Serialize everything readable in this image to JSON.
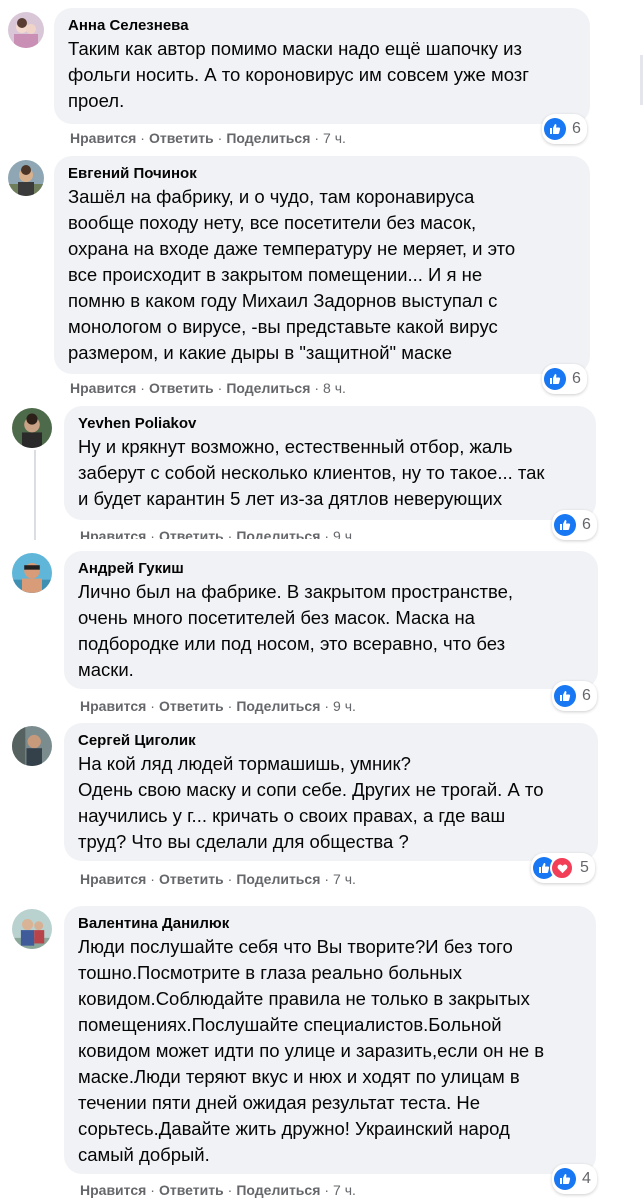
{
  "comments": [
    {
      "author": "Анна Селезнева",
      "text": "Таким как автор помимо маски надо ещё шапочку из\nфольги носить. А то короновирус им совсем уже мозг\nпроел.",
      "like": "Нравится",
      "reply": "Ответить",
      "share": "Поделиться",
      "time": "7 ч.",
      "reactions": "6",
      "reaction_types": [
        "like"
      ]
    },
    {
      "author": "Евгений Починок",
      "text": "Зашёл на фабрику, и о чудо, там коронавируса\nвообще походу нету, все посетители без масок,\nохрана на входе даже температуру не меряет, и это\nвсе происходит в закрытом помещении... И я не\nпомню в каком году Михаил Задорнов выступал с\nмонологом о вирусе, -вы представьте какой вирус\nразмером, и какие дыры в \"защитной\" маске",
      "like": "Нравится",
      "reply": "Ответить",
      "share": "Поделиться",
      "time": "8 ч.",
      "reactions": "6",
      "reaction_types": [
        "like"
      ]
    },
    {
      "author": "Yevhen Poliakov",
      "text": "Ну и крякнут возможно, естественный отбор, жаль\nзаберут с собой несколько клиентов, ну то такое... так\nи будет карантин 5 лет из-за дятлов неверующих",
      "like": "Нравится",
      "reply": "Ответить",
      "share": "Поделиться",
      "time": "9 ч.",
      "reactions": "6",
      "reaction_types": [
        "like"
      ]
    },
    {
      "author": "Андрей Гукиш",
      "text": "Лично был на фабрике. В закрытом пространстве,\nочень много посетителей без масок. Маска на\nподбородке или под носом, это всеравно, что без\nмаски.",
      "like": "Нравится",
      "reply": "Ответить",
      "share": "Поделиться",
      "time": "9 ч.",
      "reactions": "6",
      "reaction_types": [
        "like"
      ]
    },
    {
      "author": "Сергей Циголик",
      "text": "На кой ляд людей тормашишь, умник?\nОдень свою маску и сопи себе. Других не трогай. А то\nнаучились у г... кричать о своих правах, а где ваш\nтруд? Что вы сделали для общества ?",
      "like": "Нравится",
      "reply": "Ответить",
      "share": "Поделиться",
      "time": "7 ч.",
      "reactions": "5",
      "reaction_types": [
        "like",
        "love"
      ]
    },
    {
      "author": "Валентина Данилюк",
      "text": "Люди послушайте себя что Вы творите?И без того\nтошно.Посмотрите в глаза реально больных\nковидом.Соблюдайте правила не только в закрытых\nпомещениях.Послушайте специалистов.Больной\nковидом может идти по улице и заразить,если он не в\nмаске.Люди теряют вкус и нюх и ходят по улицам в\nтечении пяти дней ожидая результат теста. Не\nсорьтесь.Давайте жить дружно! Украинский народ\nсамый добрый.",
      "like": "Нравится",
      "reply": "Ответить",
      "share": "Поделиться",
      "time": "7 ч.",
      "reactions": "4",
      "reaction_types": [
        "like"
      ]
    }
  ],
  "colors": {
    "bubble": "#f0f2f5",
    "meta": "#65676b",
    "like_blue": "#1877f2",
    "love_red": "#f33e58"
  }
}
